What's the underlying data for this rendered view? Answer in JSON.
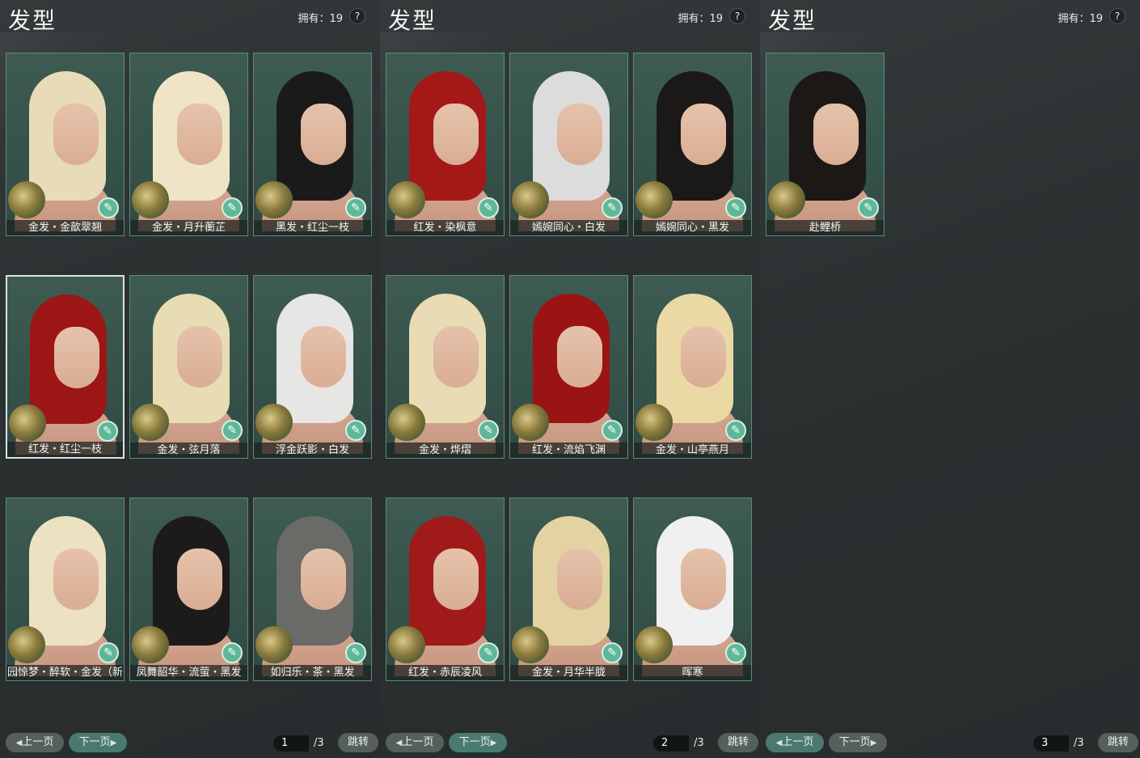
{
  "panels": [
    {
      "title": "发型",
      "owned": "拥有：19",
      "help": "?",
      "cards": [
        {
          "label": "金发・金歆翠翘",
          "hair": "#e8dcb8"
        },
        {
          "label": "金发・月升蘅芷",
          "hair": "#efe4c6"
        },
        {
          "label": "黑发・红尘一枝",
          "hair": "#1b1a1a"
        },
        {
          "label": "红发・红尘一枝",
          "hair": "#9c1616"
        },
        {
          "label": "金发・弦月落",
          "hair": "#e8dcb4"
        },
        {
          "label": "浮金跃影・白发",
          "hair": "#e6e6e4"
        },
        {
          "label": "园惊梦・醉软・金发（新",
          "hair": "#ece1c0"
        },
        {
          "label": "凤舞韶华・流萤・黑发",
          "hair": "#1d1b1a"
        },
        {
          "label": "如归乐・茶・黑发",
          "hair": "#6a6a66"
        }
      ],
      "prev": "上一页",
      "next": "下一页",
      "page": "1",
      "total": "/3",
      "jump": "跳转"
    },
    {
      "title": "发型",
      "owned": "拥有：19",
      "help": "?",
      "cards": [
        {
          "label": "红发・染枫意",
          "hair": "#a51818"
        },
        {
          "label": "嫣婉同心・白发",
          "hair": "#dcdcdc"
        },
        {
          "label": "嫣婉同心・黑发",
          "hair": "#1a1918"
        },
        {
          "label": "金发・烨熠",
          "hair": "#e9dcb4"
        },
        {
          "label": "红发・流焰飞渊",
          "hair": "#9a1414"
        },
        {
          "label": "金发・山亭燕月",
          "hair": "#ead9a4"
        },
        {
          "label": "红发・赤辰凌风",
          "hair": "#a01a1a"
        },
        {
          "label": "金发・月华半胧",
          "hair": "#e3d3a2"
        },
        {
          "label": "晖寒",
          "hair": "#f0f0f0"
        }
      ],
      "prev": "上一页",
      "next": "下一页",
      "page": "2",
      "total": "/3",
      "jump": "跳转"
    },
    {
      "title": "发型",
      "owned": "拥有：19",
      "help": "?",
      "cards": [
        {
          "label": "赴鲤桥",
          "hair": "#1b1816"
        }
      ],
      "prev": "上一页",
      "next": "下一页",
      "page": "3",
      "total": "/3",
      "jump": "跳转"
    }
  ],
  "dye_icon": "paintbrush-icon",
  "selected_card": "红发・红尘一枝"
}
